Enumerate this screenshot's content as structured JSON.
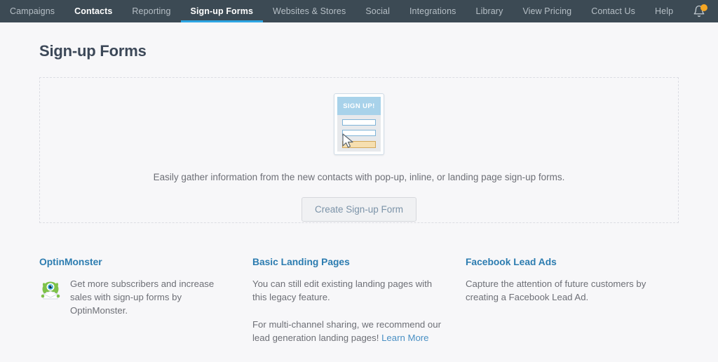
{
  "nav": {
    "left_items": [
      {
        "label": "Campaigns",
        "active": false,
        "underlined": false
      },
      {
        "label": "Contacts",
        "active": true,
        "underlined": false
      },
      {
        "label": "Reporting",
        "active": false,
        "underlined": false
      },
      {
        "label": "Sign-up Forms",
        "active": true,
        "underlined": true
      },
      {
        "label": "Websites & Stores",
        "active": false,
        "underlined": false
      },
      {
        "label": "Social",
        "active": false,
        "underlined": false
      },
      {
        "label": "Integrations",
        "active": false,
        "underlined": false
      },
      {
        "label": "Library",
        "active": false,
        "underlined": false
      }
    ],
    "right_items": [
      {
        "label": "View Pricing"
      },
      {
        "label": "Contact Us"
      },
      {
        "label": "Help"
      }
    ],
    "bell_icon": "bell-icon",
    "has_notification_badge": true,
    "bar_color": "#3c4a54",
    "active_underline_color": "#2da5e3"
  },
  "page": {
    "title": "Sign-up Forms"
  },
  "hero": {
    "illustration": {
      "name": "signup-form-illustration",
      "header_text": "SIGN UP!",
      "header_color": "#a8d2ea",
      "button_color": "#f6dfb0",
      "cursor_icon": "cursor-arrow-icon"
    },
    "description": "Easily gather information from the new contacts with pop-up, inline, or landing page sign-up forms.",
    "create_button": "Create Sign-up Form"
  },
  "columns": [
    {
      "title": "OptinMonster",
      "icon": "optinmonster-monster-icon",
      "paragraphs": [
        "Get more subscribers and increase sales with sign-up forms by OptinMonster."
      ],
      "link_text": null
    },
    {
      "title": "Basic Landing Pages",
      "icon": null,
      "paragraphs": [
        "You can still edit existing landing pages with this legacy feature.",
        "For multi-channel sharing, we recommend our lead generation landing pages!"
      ],
      "link_text": "Learn More"
    },
    {
      "title": "Facebook Lead Ads",
      "icon": null,
      "paragraphs": [
        "Capture the attention of future customers by creating a Facebook Lead Ad."
      ],
      "link_text": null
    }
  ],
  "colors": {
    "page_background": "#f7f7f9",
    "heading": "#3c4858",
    "body_text": "#6d6f76",
    "link_blue": "#2c7cb0",
    "badge_orange": "#f5a623"
  }
}
